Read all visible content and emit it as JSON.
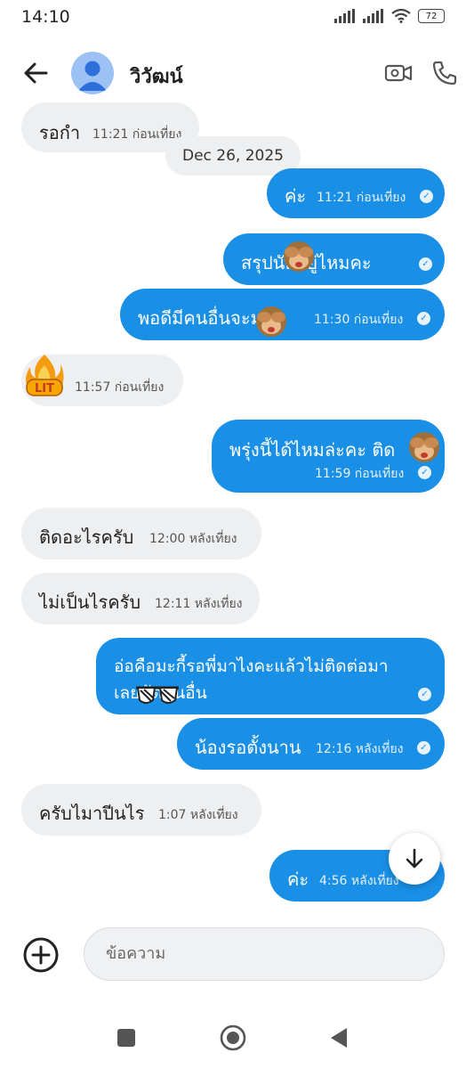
{
  "status_bar": {
    "time": "14:10",
    "battery": "72"
  },
  "header": {
    "contact_name": "วิวัฒน์"
  },
  "messages": [
    {
      "side": "in",
      "text": "รอกำ",
      "time": "11:21 ก่อนเที่ยง"
    },
    {
      "side": "out",
      "text": "ค่ะ",
      "time": "11:21 ก่อนเที่ยง"
    },
    {
      "side": "out",
      "text": "สรุปนัดอยู่ไหมคะ",
      "time": ""
    },
    {
      "side": "out",
      "text": "พอดีมีคนอื่นจะมา",
      "time": "11:30 ก่อนเที่ยง"
    },
    {
      "side": "in",
      "text": "",
      "time": "11:57 ก่อนเที่ยง",
      "sticker": "lit-fire-sticker"
    },
    {
      "side": "out",
      "text": "พรุ่งนี้ได้ไหมล่ะคะ ติด",
      "time": "11:59 ก่อนเที่ยง"
    },
    {
      "side": "in",
      "text": "ติดอะไรครับ",
      "time": "12:00 หลังเที่ยง"
    },
    {
      "side": "in",
      "text": "ไม่เป็นไรครับ",
      "time": "12:11 หลังเที่ยง"
    },
    {
      "side": "out",
      "line1": "อ่อคือมะกี้รอพี่มาไงคะแล้วไม่ติดต่อมา",
      "line2": "เลยนัดคนอื่น",
      "time": ""
    },
    {
      "side": "out",
      "text": "น้องรอตั้งนาน",
      "time": "12:16 หลังเที่ยง"
    },
    {
      "side": "in",
      "text": "ครับไมาปีนไร",
      "time": "1:07 หลังเที่ยง"
    },
    {
      "side": "out",
      "text": "ค่ะ",
      "time": "4:56 หลังเที่ยง"
    }
  ],
  "date_separator": "Dec 26, 2025",
  "composer": {
    "placeholder": "ข้อความ"
  },
  "colors": {
    "outgoing": "#1a8fe6",
    "incoming": "#edeff1",
    "avatar": "#9cc2f5"
  },
  "icons": [
    "back-arrow-icon",
    "video-call-icon",
    "phone-icon",
    "add-circle-icon",
    "arrow-down-icon",
    "see-no-evil-monkey-emoji",
    "lit-fire-sticker",
    "sunglasses-emoji",
    "nav-square-icon",
    "nav-home-icon",
    "nav-back-icon"
  ]
}
